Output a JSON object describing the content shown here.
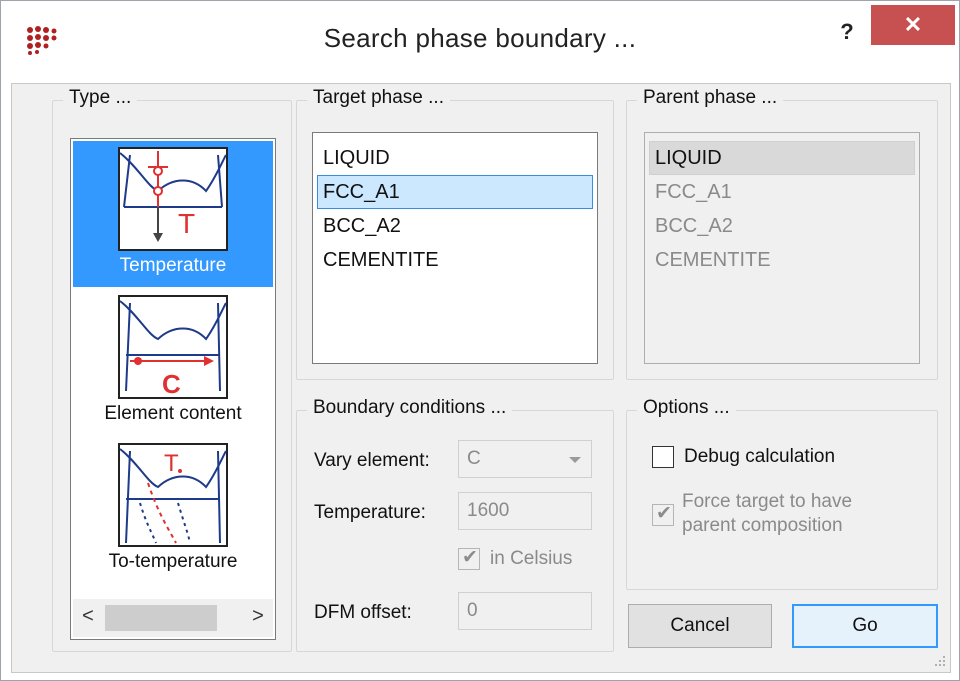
{
  "window": {
    "title": "Search  phase boundary ...",
    "help_label": "?",
    "close_label": "✕",
    "app_icon": "dots-logo-icon"
  },
  "type_group": {
    "title": "Type ...",
    "items": [
      {
        "label": "Temperature",
        "icon": "temperature-phase-diagram-icon",
        "selected": true
      },
      {
        "label": "Element content",
        "icon": "element-content-phase-diagram-icon",
        "selected": false
      },
      {
        "label": "To-temperature",
        "icon": "to-temperature-phase-diagram-icon",
        "selected": false
      }
    ],
    "scroll_left": "<",
    "scroll_right": ">"
  },
  "target_phase": {
    "title": "Target phase ...",
    "items": [
      "LIQUID",
      "FCC_A1",
      "BCC_A2",
      "CEMENTITE"
    ],
    "selected": "FCC_A1"
  },
  "parent_phase": {
    "title": "Parent phase ...",
    "items": [
      "LIQUID",
      "FCC_A1",
      "BCC_A2",
      "CEMENTITE"
    ],
    "selected": "LIQUID"
  },
  "boundary_conditions": {
    "title": "Boundary conditions ...",
    "vary_element_label": "Vary element:",
    "vary_element_value": "C",
    "temperature_label": "Temperature:",
    "temperature_value": "1600",
    "in_celsius_label": "in Celsius",
    "in_celsius_checked": true,
    "dfm_offset_label": "DFM offset:",
    "dfm_offset_value": "0"
  },
  "options": {
    "title": "Options ...",
    "debug_label": "Debug calculation",
    "debug_checked": false,
    "force_label_line1": "Force target to have",
    "force_label_line2": "parent composition",
    "force_checked": true
  },
  "buttons": {
    "cancel": "Cancel",
    "go": "Go"
  },
  "colors": {
    "selection_blue": "#3399ff",
    "close_red": "#c75050",
    "diagram_red": "#e03030"
  }
}
